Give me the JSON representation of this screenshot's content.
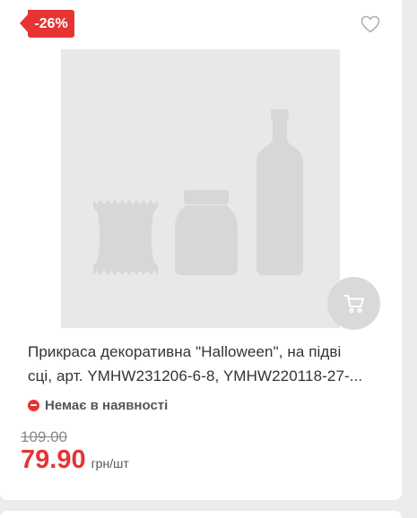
{
  "product": {
    "discount_badge": "-26%",
    "title_line1": "Прикраса декоративна \"Halloween\", на підві",
    "title_line2": "сці, арт. YMHW231206-6-8, YMHW220118-27-...",
    "stock_status": "Немає в наявності",
    "old_price": "109.00",
    "price": "79.90",
    "unit": "грн/шт"
  },
  "icons": {
    "favorite": "heart-outline-icon",
    "cart": "cart-icon",
    "out_of_stock": "minus-circle-icon",
    "placeholder": "product-placeholder-image"
  },
  "colors": {
    "accent": "#e63434",
    "placeholder_bg": "#e8e8e8",
    "placeholder_shape": "#d7d7d7",
    "cart_button_bg": "#d9d9d9"
  }
}
